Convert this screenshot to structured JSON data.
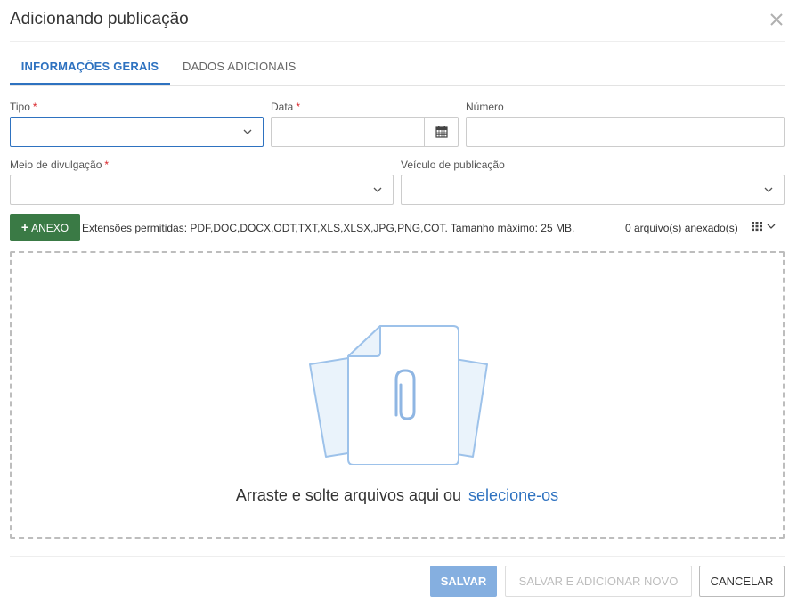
{
  "dialog": {
    "title": "Adicionando publicação"
  },
  "tabs": [
    {
      "label": "INFORMAÇÕES GERAIS",
      "active": true
    },
    {
      "label": "DADOS ADICIONAIS",
      "active": false
    }
  ],
  "form": {
    "tipo": {
      "label": "Tipo",
      "required_mark": "*",
      "value": ""
    },
    "data": {
      "label": "Data",
      "required_mark": "*",
      "value": ""
    },
    "numero": {
      "label": "Número",
      "value": ""
    },
    "meio": {
      "label": "Meio de divulgação",
      "required_mark": "*",
      "value": ""
    },
    "veiculo": {
      "label": "Veículo de publicação",
      "value": ""
    }
  },
  "attachments": {
    "add_button_icon": "+",
    "add_button_label": "ANEXO",
    "allowed_text": "Extensões permitidas: PDF,DOC,DOCX,ODT,TXT,XLS,XLSX,JPG,PNG,COT. Tamanho máximo: 25 MB.",
    "count_text": "0 arquivo(s) anexado(s)",
    "view_icon": "grid-view-icon"
  },
  "dropzone": {
    "text": "Arraste e solte arquivos aqui ou",
    "link": "selecione-os",
    "illustration": "paperclip-document-icon"
  },
  "footer": {
    "save_label": "SALVAR",
    "save_new_label": "SALVAR E ADICIONAR NOVO",
    "cancel_label": "CANCELAR"
  },
  "colors": {
    "accent": "#2e72c0",
    "required": "#d9262b",
    "anexo_button": "#3a7a45",
    "save_disabled": "#85afe0"
  }
}
